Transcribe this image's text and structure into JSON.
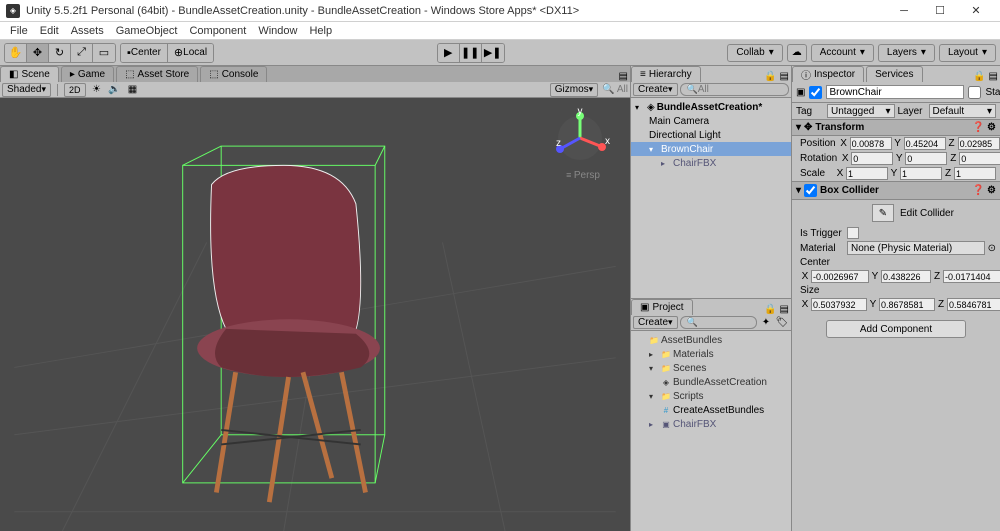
{
  "window": {
    "title": "Unity 5.5.2f1 Personal (64bit) - BundleAssetCreation.unity - BundleAssetCreation - Windows Store Apps* <DX11>"
  },
  "menu": [
    "File",
    "Edit",
    "Assets",
    "GameObject",
    "Component",
    "Window",
    "Help"
  ],
  "toolbar": {
    "center": "Center",
    "local": "Local",
    "collab": "Collab",
    "account": "Account",
    "layers": "Layers",
    "layout": "Layout"
  },
  "sceneTabs": {
    "scene": "Scene",
    "game": "Game",
    "assetStore": "Asset Store",
    "console": "Console"
  },
  "sceneBar": {
    "shaded": "Shaded",
    "twoD": "2D",
    "gizmos": "Gizmos",
    "searchPlaceholder": "All"
  },
  "persp": "Persp",
  "hierarchy": {
    "title": "Hierarchy",
    "create": "Create",
    "searchPlaceholder": "All",
    "root": "BundleAssetCreation*",
    "items": [
      "Main Camera",
      "Directional Light",
      "BrownChair"
    ],
    "child": "ChairFBX"
  },
  "project": {
    "title": "Project",
    "create": "Create",
    "items": [
      {
        "t": "folder",
        "n": "AssetBundles"
      },
      {
        "t": "folder-open",
        "n": "Materials"
      },
      {
        "t": "folder-open",
        "n": "Scenes"
      },
      {
        "t": "scene",
        "n": "BundleAssetCreation",
        "ind": 1
      },
      {
        "t": "folder-open",
        "n": "Scripts"
      },
      {
        "t": "script",
        "n": "CreateAssetBundles",
        "ind": 1
      },
      {
        "t": "prefab",
        "n": "ChairFBX"
      }
    ]
  },
  "inspector": {
    "title": "Inspector",
    "services": "Services",
    "name": "BrownChair",
    "static": "Static",
    "tag": "Tag",
    "tagVal": "Untagged",
    "layer": "Layer",
    "layerVal": "Default",
    "transform": {
      "title": "Transform",
      "position": "Position",
      "rotation": "Rotation",
      "scale": "Scale",
      "pos": {
        "x": "0.00878",
        "y": "0.45204",
        "z": "0.02985"
      },
      "rot": {
        "x": "0",
        "y": "0",
        "z": "0"
      },
      "scl": {
        "x": "1",
        "y": "1",
        "z": "1"
      }
    },
    "box": {
      "title": "Box Collider",
      "edit": "Edit Collider",
      "trigger": "Is Trigger",
      "material": "Material",
      "matVal": "None (Physic Material)",
      "center": "Center",
      "size": "Size",
      "ctr": {
        "x": "-0.0026967",
        "y": "0.438226",
        "z": "-0.0171404"
      },
      "siz": {
        "x": "0.5037932",
        "y": "0.8678581",
        "z": "0.5846781"
      }
    },
    "add": "Add Component"
  }
}
